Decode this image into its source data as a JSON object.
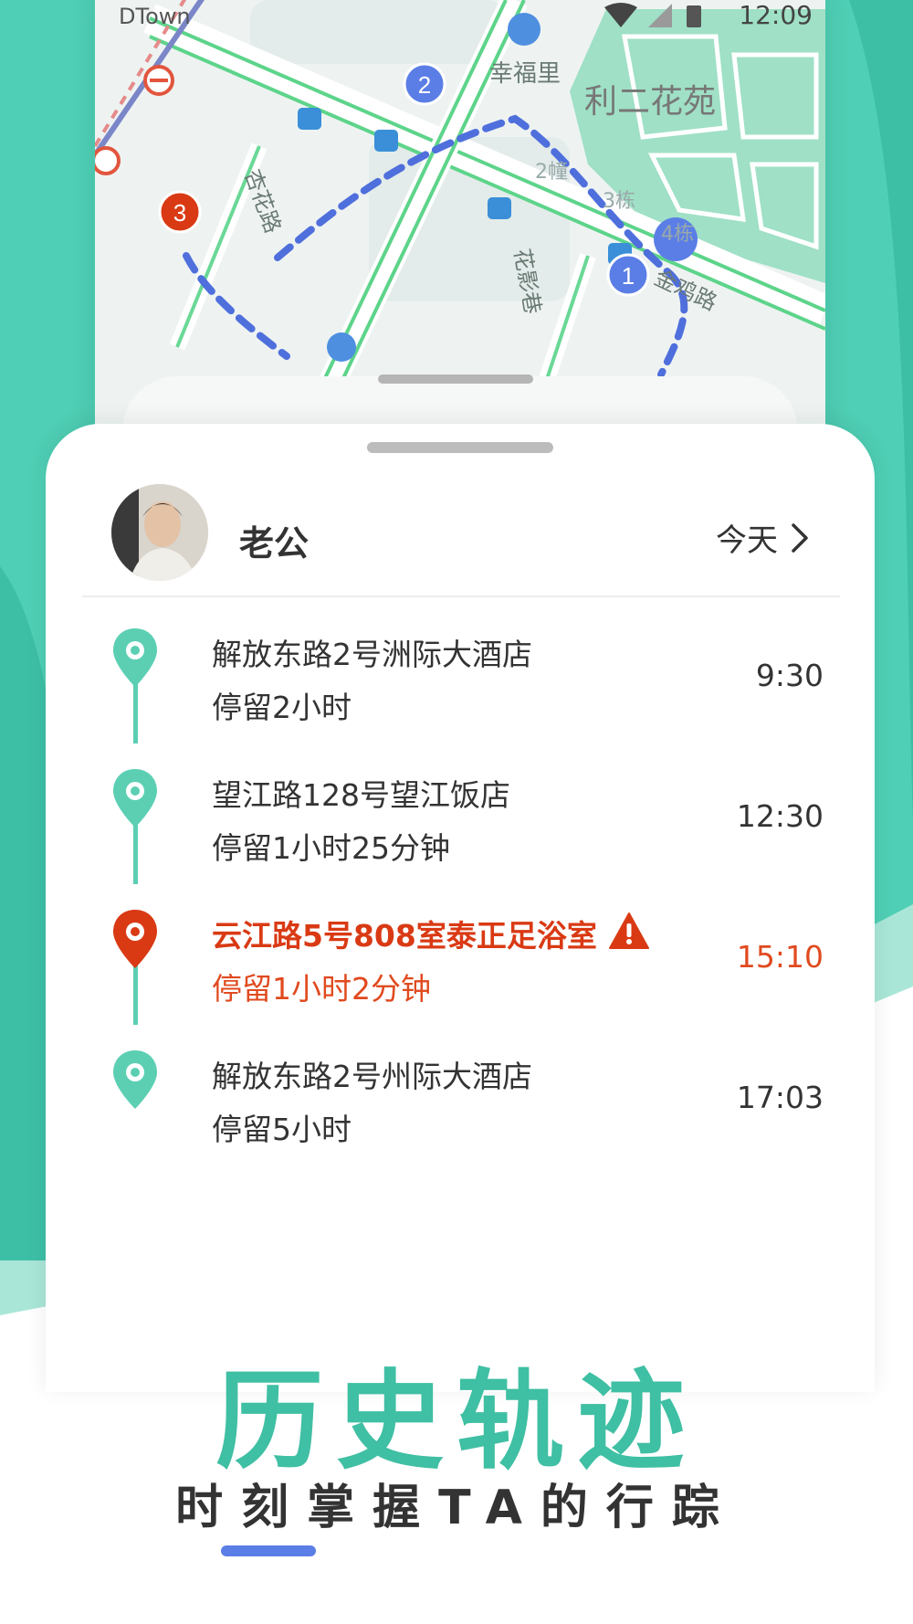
{
  "status_bar": {
    "carrier": "DTown",
    "time": "12:09"
  },
  "map": {
    "labels": {
      "area_main": "利二花苑",
      "area_small": "幸福里",
      "road_1": "杏花路",
      "road_2": "花影巷",
      "road_3": "金鸡路",
      "bld_2": "2幢",
      "bld_3": "3栋",
      "bld_4": "4栋"
    },
    "markers": [
      "1",
      "2",
      "3"
    ]
  },
  "profile": {
    "name": "老公",
    "date_filter": "今天"
  },
  "timeline": [
    {
      "place": "解放东路2号洲际大酒店",
      "stay": "停留2小时",
      "time": "9:30",
      "alert": false
    },
    {
      "place": "望江路128号望江饭店",
      "stay": "停留1小时25分钟",
      "time": "12:30",
      "alert": false
    },
    {
      "place": "云江路5号808室泰正足浴室",
      "stay": "停留1小时2分钟",
      "time": "15:10",
      "alert": true
    },
    {
      "place": "解放东路2号州际大酒店",
      "stay": "停留5小时",
      "time": "17:03",
      "alert": false
    }
  ],
  "promo": {
    "headline": "历史轨迹",
    "tagline": "时刻掌握TA的行踪"
  },
  "colors": {
    "accent_teal": "#3fbfa3",
    "alert_red": "#d93a14",
    "route_blue": "#4f6fdc",
    "underline_blue": "#5b7ee6"
  },
  "icons": [
    "wifi-icon",
    "signal-icon",
    "battery-icon",
    "chevron-right-icon",
    "location-pin-icon",
    "warning-icon"
  ]
}
